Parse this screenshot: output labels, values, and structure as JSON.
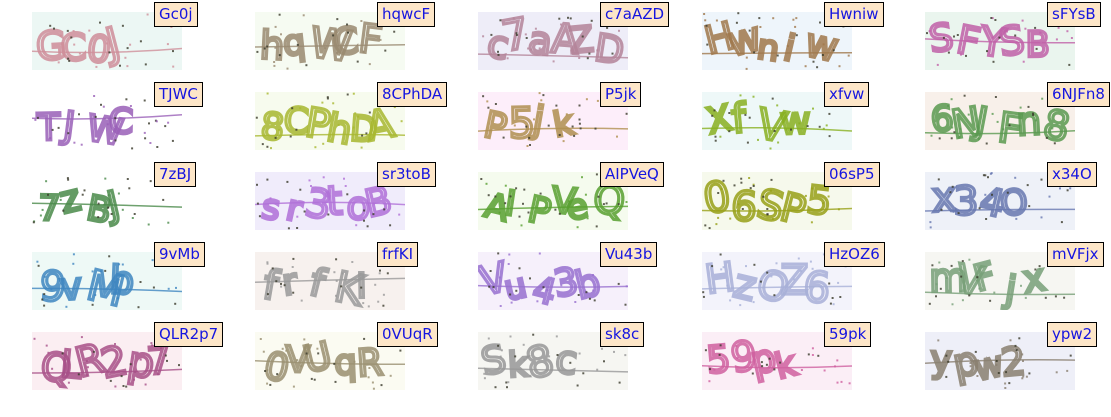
{
  "captchas": [
    {
      "label": "Gc0j",
      "text": "GC0J",
      "bg": "#ecf7f4",
      "ink": "#cf8e9a"
    },
    {
      "label": "hqwcF",
      "text": "hqWCF",
      "bg": "#f6fbf2",
      "ink": "#9a8a70"
    },
    {
      "label": "c7aAZD",
      "text": "c7aAZD",
      "bg": "#eeedf8",
      "ink": "#b4849a"
    },
    {
      "label": "Hwniw",
      "text": "Hwniw",
      "bg": "#eef5fb",
      "ink": "#a0784c"
    },
    {
      "label": "sFYsB",
      "text": "SFYSB",
      "bg": "#eaf5ee",
      "ink": "#c060a8"
    },
    {
      "label": "TJWC",
      "text": "TJWC",
      "bg": "#ffffff",
      "ink": "#9a60b8"
    },
    {
      "label": "8CPhDA",
      "text": "8CPhDA",
      "bg": "#f7fbee",
      "ink": "#a8b830"
    },
    {
      "label": "P5jk",
      "text": "P5jk",
      "bg": "#fdeefa",
      "ink": "#b09050"
    },
    {
      "label": "xfvw",
      "text": "XfVw",
      "bg": "#eef8f8",
      "ink": "#88b020"
    },
    {
      "label": "6NJFn8",
      "text": "6NJFn8",
      "bg": "#f8f0ea",
      "ink": "#5a9a50"
    },
    {
      "label": "7zBJ",
      "text": "7zBJ",
      "bg": "#ffffff",
      "ink": "#4a8a4a"
    },
    {
      "label": "sr3toB",
      "text": "sr3toB",
      "bg": "#f0ecfb",
      "ink": "#b070d8"
    },
    {
      "label": "AIPVeQ",
      "text": "AIPVeQ",
      "bg": "#f5fbee",
      "ink": "#58a030"
    },
    {
      "label": "06sP5",
      "text": "06SP5",
      "bg": "#f6f9ec",
      "ink": "#98a018"
    },
    {
      "label": "x34O",
      "text": "x34O",
      "bg": "#eef1f8",
      "ink": "#6878b0"
    },
    {
      "label": "9vMb",
      "text": "9vMb",
      "bg": "#eef9f6",
      "ink": "#3f86c0"
    },
    {
      "label": "frfKI",
      "text": "frfKI",
      "bg": "#f7f1ee",
      "ink": "#9a9a9a"
    },
    {
      "label": "Vu43b",
      "text": "Vu43b",
      "bg": "#f6f0fb",
      "ink": "#9870d0"
    },
    {
      "label": "HzOZ6",
      "text": "HzOZ6",
      "bg": "#f3f3fb",
      "ink": "#a8b0d8"
    },
    {
      "label": "mVFjx",
      "text": "mVFjx",
      "bg": "#f6f6f2",
      "ink": "#78a078"
    },
    {
      "label": "QLR2p7",
      "text": "QLR2p7",
      "bg": "#fbeef2",
      "ink": "#a85088"
    },
    {
      "label": "0VUqR",
      "text": "0VUqR",
      "bg": "#fbfbf2",
      "ink": "#9a9070"
    },
    {
      "label": "sk8c",
      "text": "Sk8c",
      "bg": "#f6f6f2",
      "ink": "#989898"
    },
    {
      "label": "59pk",
      "text": "59pk",
      "bg": "#fbeef6",
      "ink": "#d060a0"
    },
    {
      "label": "ypw2",
      "text": "ypw2",
      "bg": "#eeeff8",
      "ink": "#8a8070"
    }
  ]
}
